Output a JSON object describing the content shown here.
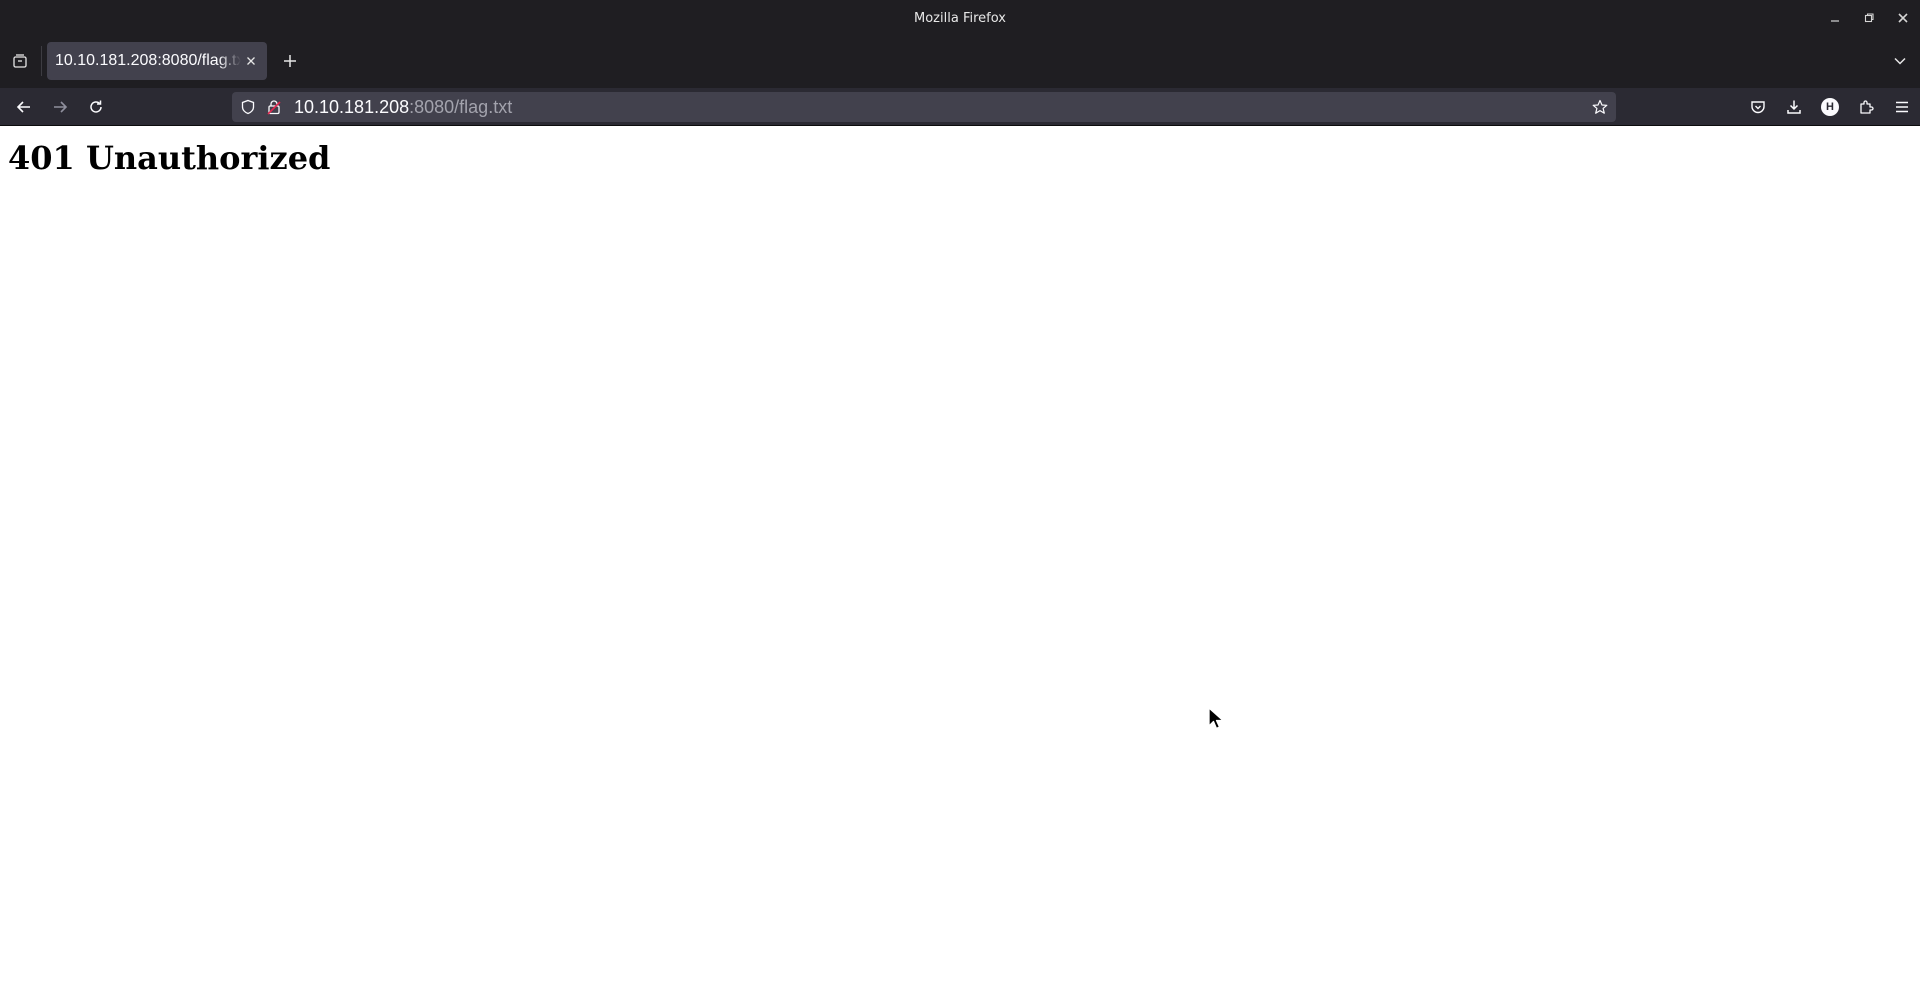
{
  "window": {
    "title": "Mozilla Firefox"
  },
  "tabs": [
    {
      "label": "10.10.181.208:8080/flag.txt",
      "active": true
    }
  ],
  "urlbar": {
    "host": "10.10.181.208",
    "path": ":8080/flag.txt"
  },
  "page": {
    "heading": "401 Unauthorized"
  },
  "toolbar": {
    "account_initial": "H"
  },
  "colors": {
    "titlebar_bg": "#1f1e22",
    "navbar_bg": "#2b2a33",
    "urlbar_bg": "#42414d",
    "tab_active_bg": "#42414d",
    "url_path_gray": "#a3a3ad",
    "content_bg": "#ffffff"
  },
  "icons": [
    "minimize-icon",
    "maximize-icon",
    "close-icon",
    "tab-manager-icon",
    "tab-close-icon",
    "plus-icon",
    "chevron-down-icon",
    "back-arrow-icon",
    "forward-arrow-icon",
    "reload-icon",
    "shield-icon",
    "lock-warning-icon",
    "star-icon",
    "pocket-icon",
    "download-icon",
    "account-icon",
    "extensions-icon",
    "hamburger-menu-icon",
    "mouse-cursor-icon"
  ]
}
